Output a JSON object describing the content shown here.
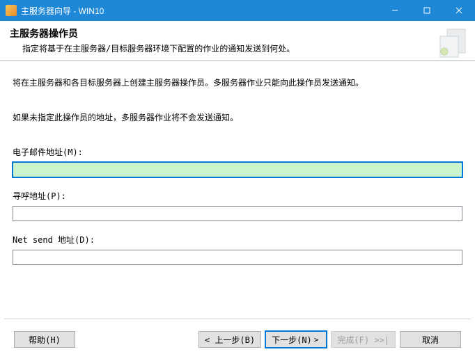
{
  "window": {
    "title": "主服务器向导 - WIN10"
  },
  "header": {
    "title": "主服务器操作员",
    "subtitle": "指定将基于在主服务器/目标服务器环境下配置的作业的通知发送到何处。"
  },
  "body": {
    "line1": "将在主服务器和各目标服务器上创建主服务器操作员。多服务器作业只能向此操作员发送通知。",
    "line2": "如果未指定此操作员的地址，多服务器作业将不会发送通知。",
    "email_label": "电子邮件地址(M):",
    "email_value": "",
    "pager_label": "寻呼地址(P):",
    "pager_value": "",
    "netsend_label": "Net send 地址(D):",
    "netsend_value": ""
  },
  "footer": {
    "help": "帮助(H)",
    "back": "< 上一步(B)",
    "next_left": "下一步(N)",
    "next_right": ">",
    "finish": "完成(F) >>|",
    "cancel": "取消"
  }
}
